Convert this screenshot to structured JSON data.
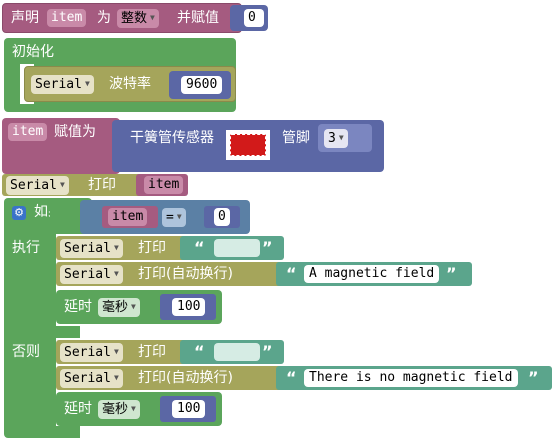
{
  "declare": {
    "label": "声明",
    "var": "item",
    "mid": "为",
    "type": "整数",
    "end": "并赋值",
    "value": "0"
  },
  "init": {
    "label": "初始化",
    "serial": "Serial",
    "baud_label": "波特率",
    "baud": "9600"
  },
  "assign": {
    "var": "item",
    "label": "赋值为",
    "sensor_label": "干簧管传感器",
    "pin_label": "管脚",
    "pin": "3"
  },
  "print1": {
    "serial": "Serial",
    "label": "打印",
    "var": "item"
  },
  "ifblock": {
    "if_label": "如果",
    "var": "item",
    "op": "=",
    "value": "0",
    "do_label": "执行",
    "else_label": "否则"
  },
  "do_print": {
    "serial": "Serial",
    "label": "打印",
    "text": ""
  },
  "do_println": {
    "serial": "Serial",
    "label": "打印(自动换行)",
    "text": "A magnetic field"
  },
  "do_delay": {
    "label": "延时",
    "unit": "毫秒",
    "value": "100"
  },
  "else_print": {
    "serial": "Serial",
    "label": "打印",
    "text": ""
  },
  "else_println": {
    "serial": "Serial",
    "label": "打印(自动换行)",
    "text": "There is no magnetic field"
  },
  "else_delay": {
    "label": "延时",
    "unit": "毫秒",
    "value": "100"
  },
  "quote_open": "“",
  "quote_close": "”",
  "colors": {
    "var": "#a55b80",
    "math": "#5b67a5",
    "serial": "#a5a55b",
    "text": "#5ba58c",
    "logic": "#5b80a5",
    "control": "#5ba55b",
    "sensor": "#5b67a5"
  }
}
